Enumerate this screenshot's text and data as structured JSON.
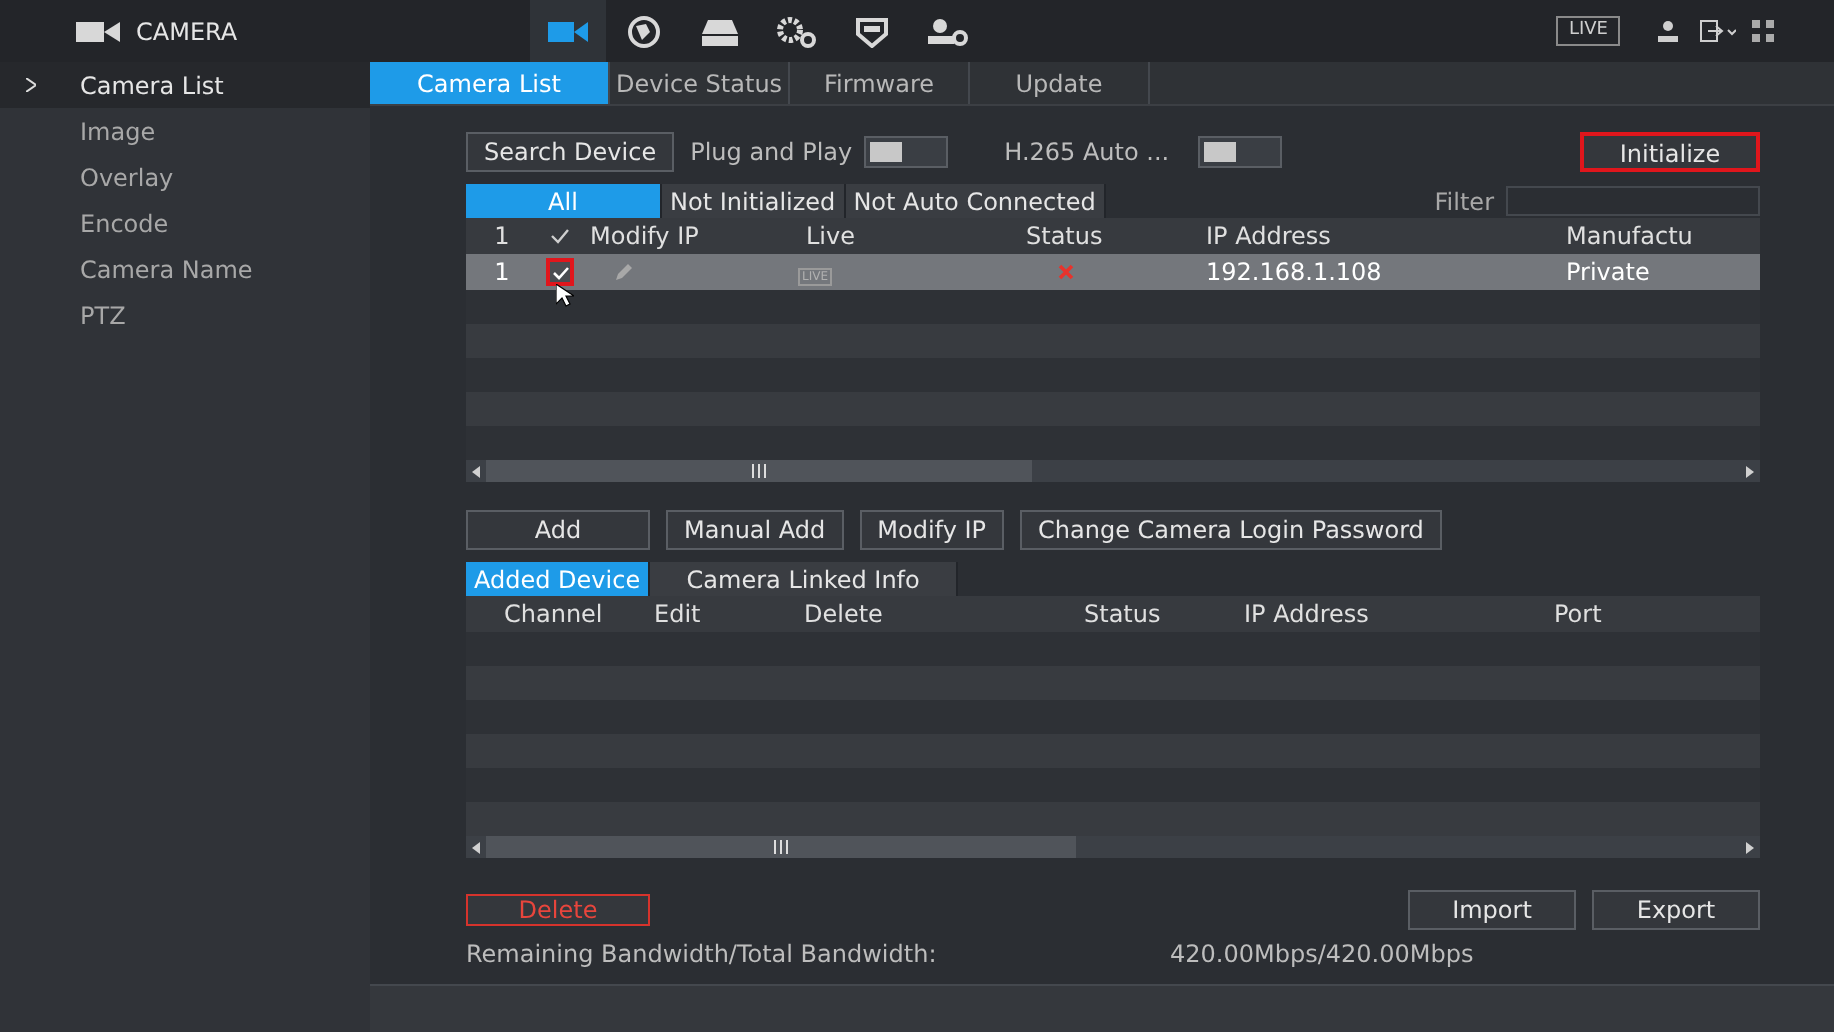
{
  "header": {
    "title": "CAMERA",
    "live_label": "LIVE",
    "modules": [
      {
        "kind": "camera",
        "selected": true
      },
      {
        "kind": "network",
        "selected": false
      },
      {
        "kind": "storage",
        "selected": false
      },
      {
        "kind": "system",
        "selected": false
      },
      {
        "kind": "security",
        "selected": false
      },
      {
        "kind": "account",
        "selected": false
      }
    ]
  },
  "sidebar": {
    "items": [
      {
        "label": "Camera List",
        "selected": true
      },
      {
        "label": "Image",
        "selected": false
      },
      {
        "label": "Overlay",
        "selected": false
      },
      {
        "label": "Encode",
        "selected": false
      },
      {
        "label": "Camera Name",
        "selected": false
      },
      {
        "label": "PTZ",
        "selected": false
      }
    ]
  },
  "tabs": [
    {
      "label": "Camera List",
      "selected": true
    },
    {
      "label": "Device Status",
      "selected": false
    },
    {
      "label": "Firmware",
      "selected": false
    },
    {
      "label": "Update",
      "selected": false
    }
  ],
  "toolbar": {
    "search_button": "Search Device",
    "plug_and_play": {
      "label": "Plug and Play",
      "on": false
    },
    "h265": {
      "label": "H.265 Auto ...",
      "on": false
    },
    "initialize_button": {
      "label": "Initialize",
      "highlighted": true
    }
  },
  "filter_tabs": [
    {
      "label": "All",
      "selected": true
    },
    {
      "label": "Not Initialized",
      "selected": false
    },
    {
      "label": "Not Auto Connected",
      "selected": false
    }
  ],
  "filter": {
    "label": "Filter"
  },
  "search_table": {
    "count": "1",
    "all_checked": true,
    "columns": [
      "Modify IP",
      "Live",
      "Status",
      "IP Address",
      "Manufactu"
    ],
    "rows": [
      {
        "index": "1",
        "checked": true,
        "highlighted": true,
        "selected": true,
        "live": "LIVE",
        "connected": false,
        "ip": "192.168.1.108",
        "manufacturer": "Private"
      }
    ]
  },
  "actions": [
    "Add",
    "Manual Add",
    "Modify IP",
    "Change Camera Login Password"
  ],
  "list_tabs": [
    {
      "label": "Added Device",
      "selected": true
    },
    {
      "label": "Camera Linked Info",
      "selected": false
    }
  ],
  "added_table": {
    "columns": [
      "Channel",
      "Edit",
      "Delete",
      "Status",
      "IP Address",
      "Port"
    ]
  },
  "footer": {
    "delete_button": "Delete",
    "import_button": "Import",
    "export_button": "Export",
    "bandwidth_label": "Remaining Bandwidth/Total Bandwidth:",
    "bandwidth_value": "420.00Mbps/420.00Mbps"
  }
}
